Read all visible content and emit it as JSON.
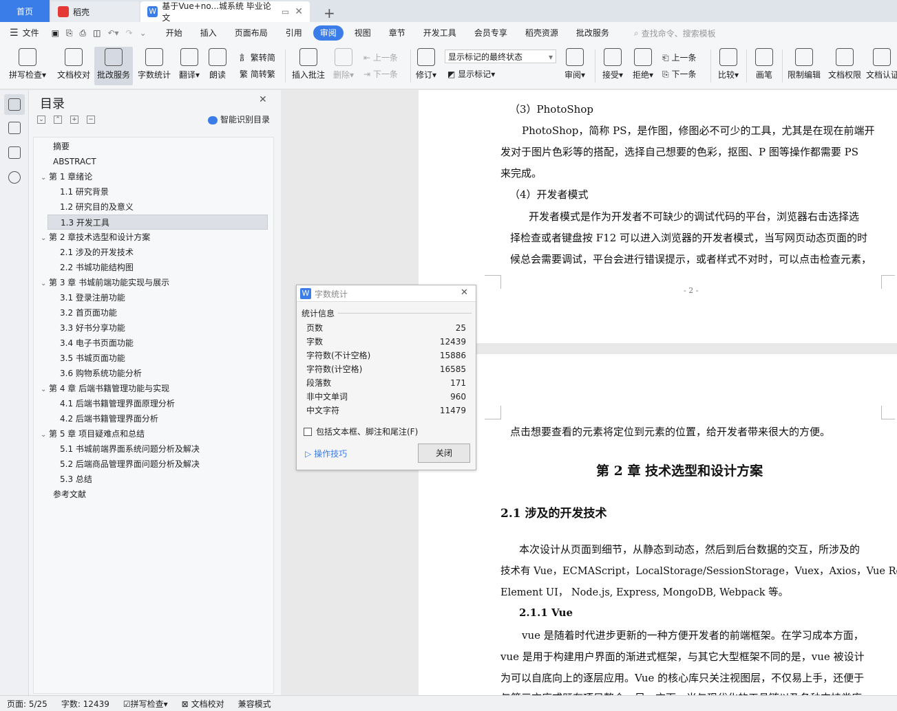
{
  "tabs": {
    "home": "首页",
    "daoke": "稻壳",
    "doc": "基于Vue+no...城系统 毕业论文",
    "add": "+"
  },
  "menu": {
    "file": "文件",
    "items": [
      "开始",
      "插入",
      "页面布局",
      "引用",
      "审阅",
      "视图",
      "章节",
      "开发工具",
      "会员专享",
      "稻壳资源",
      "批改服务"
    ],
    "active": "审阅",
    "search_placeholder": "查找命令、搜索模板"
  },
  "ribbon": {
    "spell": "拼写检查",
    "proof": "文档校对",
    "correct": "批改服务",
    "wordcount": "字数统计",
    "translate": "翻译",
    "read": "朗读",
    "trad": "繁转简",
    "simp": "简转繁",
    "insert_comment": "插入批注",
    "delete": "删除",
    "prev": "上一条",
    "next": "下一条",
    "track": "修订",
    "markup_state": "显示标记的最终状态",
    "show_markup": "显示标记",
    "review": "审阅",
    "accept": "接受",
    "reject": "拒绝",
    "prev2": "上一条",
    "next2": "下一条",
    "compare": "比较",
    "pen": "画笔",
    "restrict": "限制编辑",
    "perm": "文档权限",
    "cert": "文档认证"
  },
  "toc": {
    "title": "目录",
    "smart": "智能识别目录",
    "items": [
      {
        "text": "摘要",
        "level": 0,
        "caret": false
      },
      {
        "text": "ABSTRACT",
        "level": 0,
        "caret": false
      },
      {
        "text": "第 1 章绪论",
        "level": 0,
        "caret": true
      },
      {
        "text": "1.1  研究背景",
        "level": 1,
        "caret": false
      },
      {
        "text": "1.2  研究目的及意义",
        "level": 1,
        "caret": false
      },
      {
        "text": "1.3  开发工具",
        "level": 1,
        "caret": false,
        "selected": true
      },
      {
        "text": "第 2 章技术选型和设计方案",
        "level": 0,
        "caret": true
      },
      {
        "text": "2.1  涉及的开发技术",
        "level": 1,
        "caret": false
      },
      {
        "text": "2.2  书城功能结构图",
        "level": 1,
        "caret": false
      },
      {
        "text": "第 3 章  书城前端功能实现与展示",
        "level": 0,
        "caret": true
      },
      {
        "text": "3.1  登录注册功能",
        "level": 1,
        "caret": false
      },
      {
        "text": "3.2  首页面功能",
        "level": 1,
        "caret": false
      },
      {
        "text": "3.3  好书分享功能",
        "level": 1,
        "caret": false
      },
      {
        "text": "3.4  电子书页面功能",
        "level": 1,
        "caret": false
      },
      {
        "text": "3.5  书城页面功能",
        "level": 1,
        "caret": false
      },
      {
        "text": "3.6  购物系统功能分析",
        "level": 1,
        "caret": false
      },
      {
        "text": "第 4 章  后端书籍管理功能与实现",
        "level": 0,
        "caret": true
      },
      {
        "text": "4.1  后端书籍管理界面原理分析",
        "level": 1,
        "caret": false
      },
      {
        "text": "4.2  后端书籍管理界面分析",
        "level": 1,
        "caret": false
      },
      {
        "text": "第 5 章  项目疑难点和总结",
        "level": 0,
        "caret": true
      },
      {
        "text": "5.1  书城前端界面系统问题分析及解决",
        "level": 1,
        "caret": false
      },
      {
        "text": "5.2  后端商品管理界面问题分析及解决",
        "level": 1,
        "caret": false
      },
      {
        "text": "5.3  总结",
        "level": 1,
        "caret": false
      },
      {
        "text": "参考文献",
        "level": 0,
        "caret": false
      }
    ]
  },
  "doc": {
    "p1_head": "（3）PhotoShop",
    "p1_l1": "PhotoShop，简称 PS，是作图，修图必不可少的工具，尤其是在现在前端开",
    "p1_l2": "发对于图片色彩等的搭配，选择自己想要的色彩，抠图、P 图等操作都需要 PS",
    "p1_l3": "来完成。",
    "p2_head": "（4）开发者模式",
    "p2_l1": "开发者模式是作为开发者不可缺少的调试代码的平台，浏览器右击选择选",
    "p2_l2": "择检查或者键盘按 F12 可以进入浏览器的开发者模式，当写网页动态页面的时",
    "p2_l3": "候总会需要调试，平台会进行错误提示，或者样式不对时，可以点击检查元素，",
    "page_num": "- 2 -",
    "p3_l1": "点击想要查看的元素将定位到元素的位置，给开发者带来很大的方便。",
    "chapter": "第 2 章    技术选型和设计方案",
    "sec21": "2.1  涉及的开发技术",
    "p4_l1": "本次设计从页面到细节，从静态到动态，然后到后台数据的交互，所涉及的",
    "p4_l2": "技术有 Vue，ECMAScript，LocalStorage/SessionStorage，Vuex，Axios，Vue Router，",
    "p4_l3": "Element UI，  Node.js, Express, MongoDB, Webpack 等。",
    "sec211": "2.1.1    Vue",
    "p5_l1": "vue 是随着时代进步更新的一种方便开发者的前端框架。在学习成本方面，",
    "p5_l2": "vue 是用于构建用户界面的渐进式框架，与其它大型框架不同的是，vue 被设计",
    "p5_l3": "为可以自底向上的逐层应用。Vue 的核心库只关注视图层，不仅易上手，还便于",
    "p5_l4": "与第三方库或既有项目整合。另一方面，当与现代化的工具链以及各种支持类库"
  },
  "dialog": {
    "title": "字数统计",
    "section": "统计信息",
    "rows": [
      {
        "label": "页数",
        "value": "25"
      },
      {
        "label": "字数",
        "value": "12439"
      },
      {
        "label": "字符数(不计空格)",
        "value": "15886"
      },
      {
        "label": "字符数(计空格)",
        "value": "16585"
      },
      {
        "label": "段落数",
        "value": "171"
      },
      {
        "label": "非中文单词",
        "value": "960"
      },
      {
        "label": "中文字符",
        "value": "11479"
      }
    ],
    "checkbox": "包括文本框、脚注和尾注(F)",
    "tips": "操作技巧",
    "close": "关闭"
  },
  "status": {
    "page": "页面: 5/25",
    "words": "字数: 12439",
    "spell": "拼写检查",
    "proof": "文档校对",
    "compat": "兼容模式"
  }
}
